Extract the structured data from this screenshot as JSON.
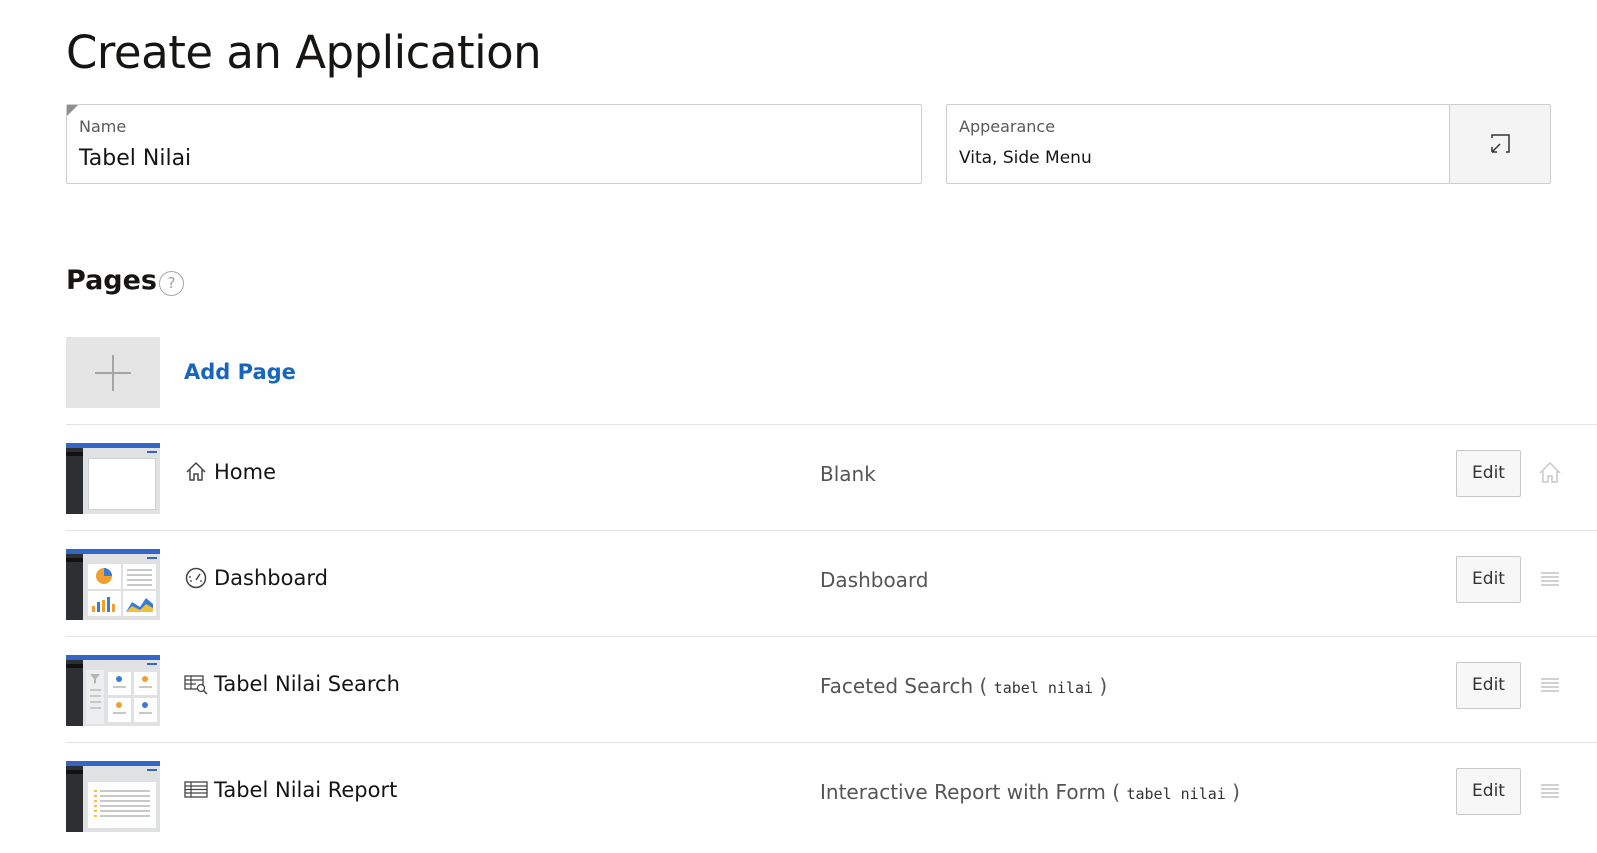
{
  "title": "Create an Application",
  "name_field": {
    "label": "Name",
    "value": "Tabel Nilai"
  },
  "appearance_field": {
    "label": "Appearance",
    "value": "Vita, Side Menu"
  },
  "pages_section": {
    "title": "Pages",
    "help": "?"
  },
  "add_page": {
    "label": "Add Page"
  },
  "pages": [
    {
      "name": "Home",
      "icon": "home-icon",
      "type": "Blank",
      "source": "",
      "edit_label": "Edit",
      "action_icon": "home-icon"
    },
    {
      "name": "Dashboard",
      "icon": "dashboard-gauge-icon",
      "type": "Dashboard",
      "source": "",
      "edit_label": "Edit",
      "action_icon": "drag-handle-icon"
    },
    {
      "name": "Tabel Nilai Search",
      "icon": "faceted-search-icon",
      "type": "Faceted Search",
      "source": "tabel nilai",
      "edit_label": "Edit",
      "action_icon": "drag-handle-icon"
    },
    {
      "name": "Tabel Nilai Report",
      "icon": "report-icon",
      "type": "Interactive Report with Form",
      "source": "tabel nilai",
      "edit_label": "Edit",
      "action_icon": "drag-handle-icon"
    }
  ]
}
